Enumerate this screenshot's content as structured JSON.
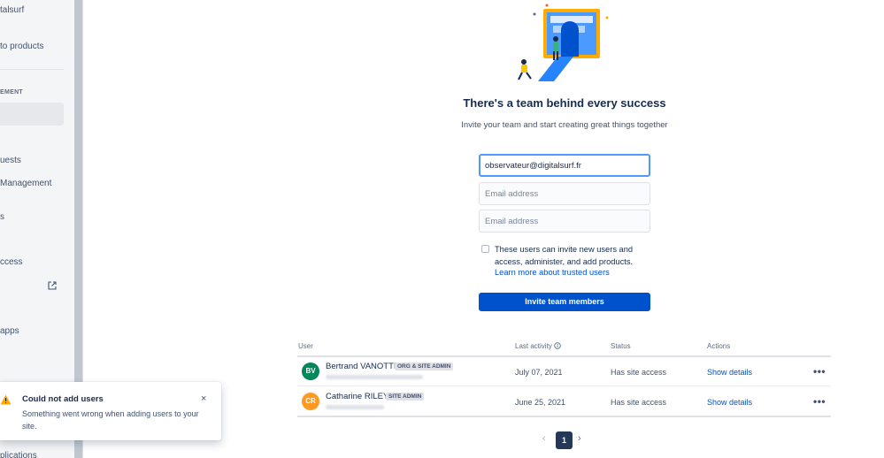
{
  "sidebar": {
    "items": [
      {
        "label": "talsurf"
      },
      {
        "label": "to products"
      },
      {
        "label": "EMENT"
      },
      {
        "label": "uests"
      },
      {
        "label": "Management"
      },
      {
        "label": "s"
      },
      {
        "label": "ccess"
      },
      {
        "label": "apps"
      },
      {
        "label": "plications"
      }
    ]
  },
  "main": {
    "title": "There's a team behind every success",
    "subtitle": "Invite your team and start creating great things together",
    "emails": [
      {
        "value": "observateur@digitalsurf.fr",
        "placeholder": "Email address"
      },
      {
        "value": "",
        "placeholder": "Email address"
      },
      {
        "value": "",
        "placeholder": "Email address"
      }
    ],
    "checkbox_label": "These users can invite new users and access, administer, and add products.",
    "trusted_link": "Learn more about trusted users",
    "invite_button": "Invite team members"
  },
  "table": {
    "headers": {
      "user": "User",
      "last_activity": "Last activity",
      "status": "Status",
      "actions": "Actions"
    },
    "rows": [
      {
        "initials": "BV",
        "avatar_color": "#00875a",
        "name": "Bertrand VANOTTI",
        "badge": "ORG & SITE ADMIN",
        "last_activity": "July 07, 2021",
        "status": "Has site access",
        "action": "Show details",
        "more": "•••"
      },
      {
        "initials": "CR",
        "avatar_color": "#ff991f",
        "name": "Catharine RILEY",
        "badge": "SITE ADMIN",
        "last_activity": "June 25, 2021",
        "status": "Has site access",
        "action": "Show details",
        "more": "•••"
      }
    ]
  },
  "pagination": {
    "prev": "‹",
    "current": "1",
    "next": "›"
  },
  "flag": {
    "title": "Could not add users",
    "description": "Something went wrong when adding users to your site.",
    "close": "×",
    "icon": "warning-icon",
    "icon_color": "#ffab00"
  },
  "colors": {
    "primary": "#0052cc",
    "text": "#172b4d",
    "subtle": "#42526e"
  }
}
